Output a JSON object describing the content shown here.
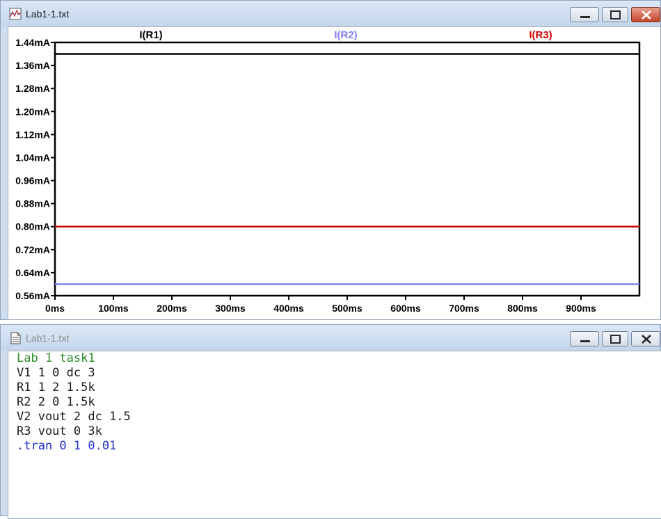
{
  "plot_window": {
    "title": "Lab1-1.txt",
    "colors": {
      "r1": "#000000",
      "r2": "#8080ee",
      "r3": "#cc0000"
    }
  },
  "text_window": {
    "title": "Lab1-1.txt",
    "lines": [
      {
        "text": "Lab 1 task1",
        "kind": "comment"
      },
      {
        "text": "V1 1 0 dc 3",
        "kind": "normal"
      },
      {
        "text": "R1 1 2 1.5k",
        "kind": "normal"
      },
      {
        "text": "R2 2 0 1.5k",
        "kind": "normal"
      },
      {
        "text": "V2 vout 2 dc 1.5",
        "kind": "normal"
      },
      {
        "text": "R3 vout 0 3k",
        "kind": "normal"
      },
      {
        "text": ".tran 0 1 0.01",
        "kind": "directive"
      }
    ]
  },
  "chart_data": {
    "type": "line",
    "title": "",
    "xlabel": "",
    "ylabel": "",
    "x_ticks": [
      "0ms",
      "100ms",
      "200ms",
      "300ms",
      "400ms",
      "500ms",
      "600ms",
      "700ms",
      "800ms",
      "900ms"
    ],
    "y_ticks": [
      "1.44mA",
      "1.36mA",
      "1.28mA",
      "1.20mA",
      "1.12mA",
      "1.04mA",
      "0.96mA",
      "0.88mA",
      "0.80mA",
      "0.72mA",
      "0.64mA",
      "0.56mA"
    ],
    "xlim": [
      0,
      1000
    ],
    "ylim": [
      0.56,
      1.44
    ],
    "x_unit": "ms",
    "y_unit": "mA",
    "grid": false,
    "legend_position": "top",
    "series": [
      {
        "name": "I(R1)",
        "x": [
          0,
          1000
        ],
        "y": [
          1.4,
          1.4
        ],
        "color": "#000000"
      },
      {
        "name": "I(R2)",
        "x": [
          0,
          1000
        ],
        "y": [
          0.6,
          0.6
        ],
        "color": "#8080ee"
      },
      {
        "name": "I(R3)",
        "x": [
          0,
          1000
        ],
        "y": [
          0.8,
          0.8
        ],
        "color": "#cc0000"
      }
    ]
  }
}
